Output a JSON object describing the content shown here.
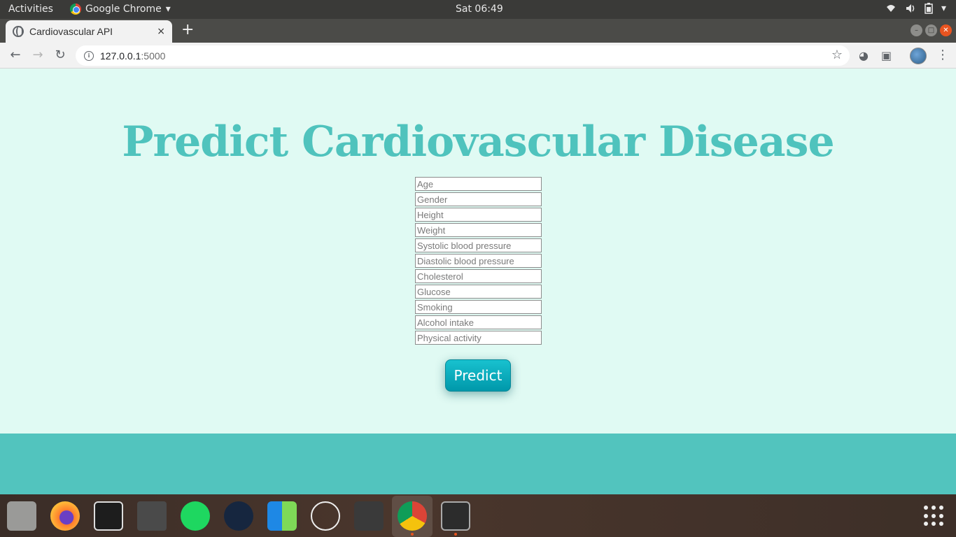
{
  "system_bar": {
    "activities": "Activities",
    "app_name": "Google Chrome",
    "app_menu_icon": "chevron-down-icon",
    "clock": "Sat 06:49",
    "tray_icons": [
      "wifi-icon",
      "volume-icon",
      "battery-icon",
      "chevron-down-icon"
    ]
  },
  "browser": {
    "tab": {
      "title": "Cardiovascular API",
      "close": "×"
    },
    "new_tab": "+",
    "url_host": "127.0.0.1",
    "url_port": ":5000"
  },
  "page": {
    "heading": "Predict Cardiovascular Disease",
    "fields": [
      {
        "placeholder": "Age"
      },
      {
        "placeholder": "Gender"
      },
      {
        "placeholder": "Height"
      },
      {
        "placeholder": "Weight"
      },
      {
        "placeholder": "Systolic blood pressure"
      },
      {
        "placeholder": "Diastolic blood pressure"
      },
      {
        "placeholder": "Cholesterol"
      },
      {
        "placeholder": "Glucose"
      },
      {
        "placeholder": "Smoking"
      },
      {
        "placeholder": "Alcohol intake"
      },
      {
        "placeholder": "Physical activity"
      }
    ],
    "predict_label": "Predict"
  },
  "colors": {
    "page_bg": "#e0faf3",
    "accent": "#4fc3bd",
    "button": "#00a9b8",
    "footer_band": "#52c4be"
  },
  "dock": {
    "items": [
      "files-icon",
      "firefox-icon",
      "system-monitor-icon",
      "calculator-icon",
      "spotify-icon",
      "steam-icon",
      "app-grid-icon",
      "network-icon",
      "sublime-text-icon",
      "chrome-icon",
      "terminal-icon"
    ]
  }
}
